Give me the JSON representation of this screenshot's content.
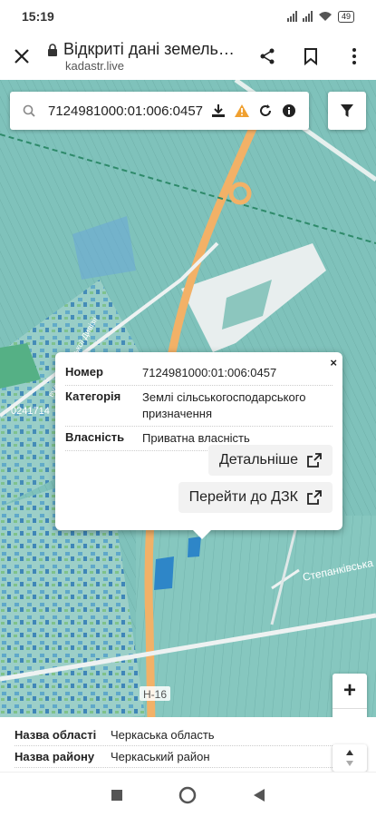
{
  "status": {
    "time": "15:19",
    "battery": "49"
  },
  "browser": {
    "title": "Відкриті дані земель…",
    "url": "kadastr.live"
  },
  "search": {
    "query": "7124981000:01:006:0457"
  },
  "map_labels": {
    "road_h16": "H-16",
    "street_east": "Степанківська",
    "street_west": "вул. Гвардійської Дивізії",
    "code_left": "0241714"
  },
  "popup": {
    "close_label": "×",
    "rows": [
      {
        "key": "Номер",
        "value": "7124981000:01:006:0457"
      },
      {
        "key": "Категорія",
        "value": "Землі сільськогосподарського призначення"
      },
      {
        "key": "Власність",
        "value": "Приватна власність"
      }
    ],
    "more_label": "Детальніше",
    "dzk_label": "Перейти до ДЗК"
  },
  "zoom": {
    "in": "+",
    "out": "−"
  },
  "info": [
    {
      "key": "Назва області",
      "value": "Черкаська область"
    },
    {
      "key": "Назва району",
      "value": "Черкаський район"
    }
  ],
  "colors": {
    "parcel": "#7fc2bb",
    "road": "#f2b167",
    "accent": "#f0a030"
  }
}
